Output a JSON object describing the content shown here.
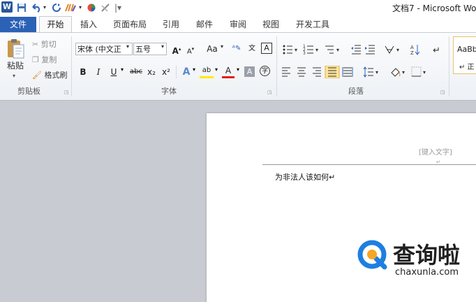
{
  "titlebar": {
    "app_icon": "W",
    "doc_title": "文档7 - Microsoft Wo",
    "qat_icons": [
      "save-icon",
      "undo-icon",
      "redo-icon",
      "paint-icon",
      "color-icon",
      "brush-icon",
      "customize-icon"
    ]
  },
  "tabs": [
    "文件",
    "开始",
    "插入",
    "页面布局",
    "引用",
    "邮件",
    "审阅",
    "视图",
    "开发工具"
  ],
  "clipboard": {
    "paste": "粘贴",
    "cut": "剪切",
    "copy": "复制",
    "format_painter": "格式刷",
    "label": "剪贴板"
  },
  "font": {
    "face": "宋体 (中文正",
    "size": "五号",
    "grow": "A",
    "shrink": "A",
    "case": "Aa",
    "bold": "B",
    "italic": "I",
    "underline": "U",
    "strike": "abc",
    "sub": "x₂",
    "sup": "x²",
    "effects": "A",
    "highlight": "ab",
    "color": "A",
    "shade": "A",
    "circle": "字",
    "phonetic": "文",
    "border": "A",
    "label": "字体"
  },
  "paragraph": {
    "label": "段落"
  },
  "styles": {
    "sample": "AaBb",
    "sample2": "↵ 正"
  },
  "document": {
    "header_placeholder": "[键入文字]",
    "body": "为非法人该如何↵"
  },
  "watermark": {
    "text": "查询啦",
    "url": "chaxunla.com"
  },
  "colors": {
    "file_tab": "#2b62b6",
    "accent": "#2b579a",
    "watermark_blue": "#1e7fe0",
    "watermark_orange": "#f5a623"
  }
}
